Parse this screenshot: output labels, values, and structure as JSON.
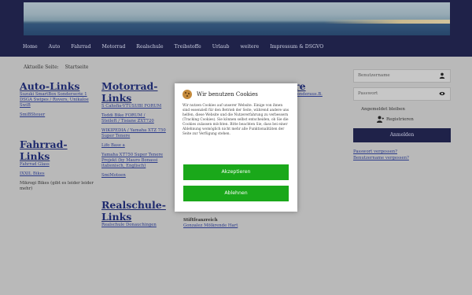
{
  "nav": [
    "Home",
    "Auto",
    "Fahrrad",
    "Motorrad",
    "Realschule",
    "Treibstoffe",
    "Urlaub",
    "weitere",
    "Impressum & DSGVO"
  ],
  "breadcrumb": [
    "Aktuelle Seite:",
    "Startseite"
  ],
  "col1": {
    "heading1": "Auto-Links",
    "links1": [
      "Suzuki SmartBox Sonderserie 1",
      "DSGA Swipes / Rovers, Unikaloe SwiB"
    ],
    "text1": "SmiBSteuer",
    "heading2": "Fahrrad-Links",
    "links2": [
      "Fahrrad Glass",
      "IXXIL Bikes"
    ],
    "text2": [
      "Mikrogi Bikes (gibt es leider leider",
      "mehr)"
    ]
  },
  "col2": {
    "heading1": "Motorrad-Links",
    "links": [
      "S Cahsfia-VTUSUBI FORUM",
      "Teddi Bike FORUM /",
      "Steileft / Tisiane ZXT720",
      "WIKIPEDIA / Yamaha XTZ 750",
      "Super Tenere",
      "Lifo Base a",
      "Yamaha XT750 Super Tenere",
      "Projekt (by Mauro Bonassi",
      "italienisch, Englisch)"
    ],
    "text": "SmiMotoen",
    "heading2": "Realschule-Links",
    "links3": [
      "Realschule Donauchingen"
    ]
  },
  "col3": {
    "heading_fragment": "re",
    "link_fragment": "Sonderaus.B.",
    "label": "Stiftfranzreich",
    "link": "Gonzalez Mölkrende Hart"
  },
  "login": {
    "username": "Benutzername",
    "password": "Passwort",
    "remember": "Angemeldet bleiben",
    "register": "Registrieren",
    "login_button": "Anmelden",
    "forgot_password": "Passwort vergessen?",
    "forgot_username": "Benutzername vergessen?"
  },
  "cookie_dialog": {
    "title": "Wir benutzen Cookies",
    "text": "Wir nutzen Cookies auf unserer Website. Einige von ihnen sind essenziell für den Betrieb der Seite, während andere uns helfen, diese Website und die Nutzererfahrung zu verbessern (Tracking Cookies). Sie können selbst entscheiden, ob Sie die Cookies zulassen möchten. Bitte beachten Sie, dass bei einer Ablehnung womöglich nicht mehr alle Funktionalitäten der Seite zur Verfügung stehen.",
    "accept": "Akzeptieren",
    "decline": "Ablehnen"
  }
}
